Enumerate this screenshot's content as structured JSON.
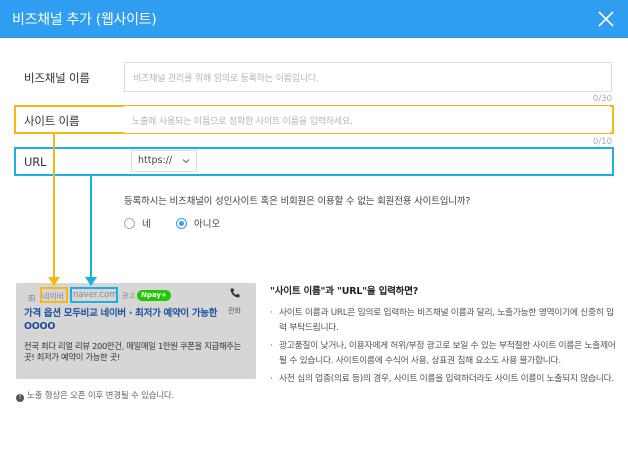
{
  "window": {
    "title": "비즈채널 추가 (웹사이트)"
  },
  "form": {
    "channel_name_label": "비즈채널 이름",
    "channel_name_placeholder": "비즈채널 관리를 위해 임의로 등록하는 이름입니다.",
    "channel_name_counter": "0/30",
    "site_name_label": "사이트 이름",
    "site_name_placeholder": "노출에 사용되는 이름으로 정확한 사이트 이름을 입력하세요.",
    "site_name_counter": "0/10",
    "url_label": "URL",
    "protocol_value": "https://",
    "adult_question": "등록하시는 비즈채널이 성인사이트 혹은 비회원은 이용할 수 없는 회원전용 사이트입니까?",
    "option_yes": "네",
    "option_no": "아니오",
    "selected_option": "아니오"
  },
  "preview": {
    "favicon": "⊞",
    "naver_label": "네이버",
    "url": "naver.com",
    "ad_label": "광고",
    "npay_label": "Npay+",
    "call_label": "전화",
    "title": "가격 옵션 모두비교 네이버 · 최저가 예약이 가능한 OOOO",
    "description": "전국 최다 리얼 리뷰 200만건, 매일매일 1만원 쿠폰을 지급해주는 곳! 최저가 예약이 가능한 곳!"
  },
  "note": "노출 형상은 오픈 이후 변경될 수 있습니다.",
  "guide": {
    "title": "\"사이트 이름\"과 \"URL\"을 입력하면?",
    "items": [
      "사이트 이름과 URL은 임의로 입력하는 비즈채널 이름과 달리, 노출가능한 영역이기에 신중히 입력 부탁드립니다.",
      "광고품질이 낮거나, 이용자에게 허위/부정 광고로 보일 수 있는 부적절한 사이트 이름은 노출제어 될 수 있습니다. 사이트이름에 수식어 사용, 상표권 침해 요소도 사용 불가합니다.",
      "사전 심의 업종(의료 등)의 경우, 사이트 이름을 입력하더라도 사이트 이름이 노출되지 않습니다."
    ]
  },
  "colors": {
    "header": "#2f9df0",
    "highlight_site_name": "#f5b916",
    "highlight_url": "#1ab0e6"
  },
  "icons": {
    "close": "close-icon",
    "chevron": "chevron-down-icon",
    "phone": "phone-icon",
    "info": "info-icon"
  }
}
